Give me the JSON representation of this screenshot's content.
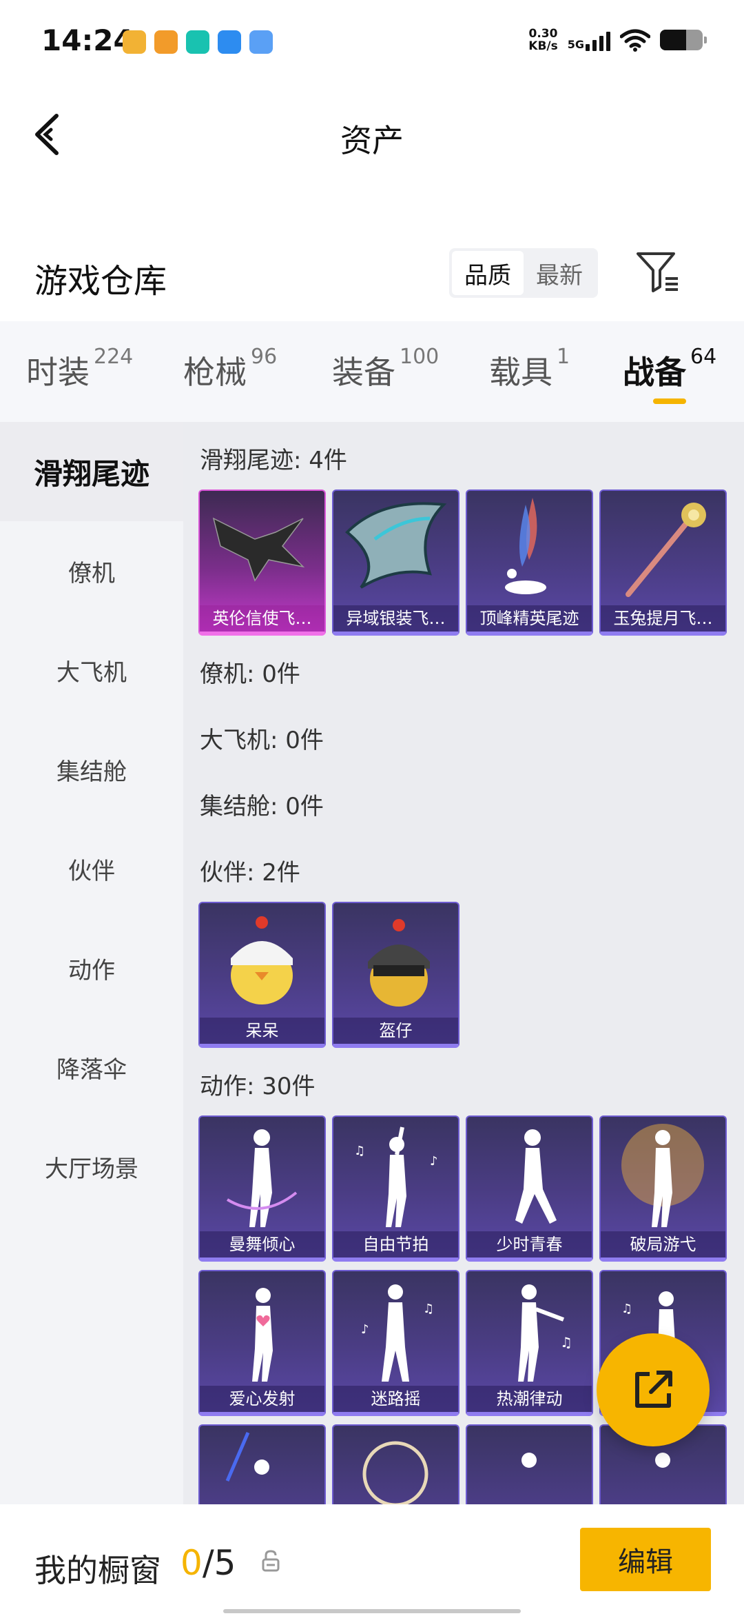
{
  "status_bar": {
    "time": "14:24",
    "net_speed_value": "0.30",
    "net_speed_unit": "KB/s",
    "network": "5G",
    "app_icon_colors": [
      "#f2b234",
      "#f29b2a",
      "#19c2b0",
      "#2d8cf0",
      "#5aa0f5"
    ]
  },
  "header": {
    "title": "资产",
    "back_icon": "chevron-left-icon"
  },
  "warehouse": {
    "title": "游戏仓库",
    "sort_options": [
      "品质",
      "最新"
    ],
    "sort_selected": "品质",
    "filter_icon": "filter-icon"
  },
  "tabs": [
    {
      "label": "时装",
      "count": "224"
    },
    {
      "label": "枪械",
      "count": "96"
    },
    {
      "label": "装备",
      "count": "100"
    },
    {
      "label": "载具",
      "count": "1"
    },
    {
      "label": "战备",
      "count": "64",
      "active": true
    }
  ],
  "side_nav": [
    {
      "label": "滑翔尾迹",
      "active": true
    },
    {
      "label": "僚机"
    },
    {
      "label": "大飞机"
    },
    {
      "label": "集结舱"
    },
    {
      "label": "伙伴"
    },
    {
      "label": "动作"
    },
    {
      "label": "降落伞"
    },
    {
      "label": "大厅场景"
    }
  ],
  "sections": {
    "glide": {
      "title": "滑翔尾迹: 4件",
      "items": [
        "英伦信使飞…",
        "异域银装飞…",
        "顶峰精英尾迹",
        "玉兔提月飞…"
      ]
    },
    "wingman": {
      "title": "僚机: 0件"
    },
    "plane": {
      "title": "大飞机: 0件"
    },
    "pod": {
      "title": "集结舱: 0件"
    },
    "companion": {
      "title": "伙伴: 2件",
      "items": [
        "呆呆",
        "盔仔"
      ]
    },
    "emote": {
      "title": "动作: 30件",
      "items": [
        "曼舞倾心",
        "自由节拍",
        "少时青春",
        "破局游弋",
        "爱心发射",
        "迷路摇",
        "热潮律动"
      ]
    }
  },
  "bottom_bar": {
    "title": "我的橱窗",
    "count_current": "0",
    "count_total": "/5",
    "edit_label": "编辑"
  },
  "colors": {
    "accent": "#f7b500",
    "card_purple": "#4b3d85",
    "card_pink": "#c239c9"
  }
}
